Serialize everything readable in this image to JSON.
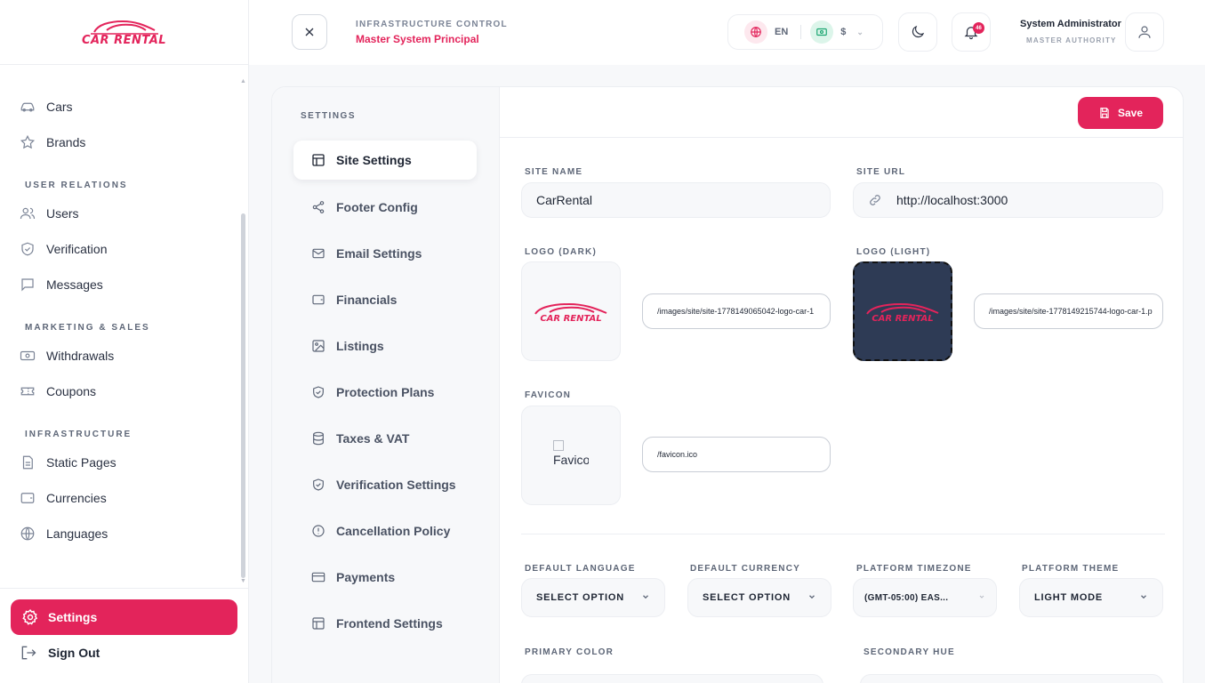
{
  "brand": {
    "logo_text": "CAR RENTAL",
    "accent": "#e3245b"
  },
  "sidebar": {
    "items_top": [
      {
        "label": "Cars",
        "icon": "car-icon"
      },
      {
        "label": "Brands",
        "icon": "star-icon"
      }
    ],
    "sections": [
      {
        "title": "USER RELATIONS",
        "items": [
          {
            "label": "Users",
            "icon": "users-icon"
          },
          {
            "label": "Verification",
            "icon": "shield-check-icon"
          },
          {
            "label": "Messages",
            "icon": "message-icon"
          }
        ]
      },
      {
        "title": "MARKETING & SALES",
        "items": [
          {
            "label": "Withdrawals",
            "icon": "banknote-icon"
          },
          {
            "label": "Coupons",
            "icon": "ticket-icon"
          }
        ]
      },
      {
        "title": "INFRASTRUCTURE",
        "items": [
          {
            "label": "Static Pages",
            "icon": "file-icon"
          },
          {
            "label": "Currencies",
            "icon": "wallet-icon"
          },
          {
            "label": "Languages",
            "icon": "globe-icon"
          }
        ]
      }
    ],
    "settings_label": "Settings",
    "signout_label": "Sign Out"
  },
  "header": {
    "kicker": "INFRASTRUCTURE CONTROL",
    "title": "Master System Principal",
    "language": "EN",
    "currency": "$",
    "notifications": "46",
    "user_name": "System Administrator",
    "user_role": "MASTER AUTHORITY"
  },
  "settings_nav": {
    "heading": "SETTINGS",
    "items": [
      {
        "label": "Site Settings",
        "icon": "layout-icon",
        "active": true
      },
      {
        "label": "Footer Config",
        "icon": "share-icon"
      },
      {
        "label": "Email Settings",
        "icon": "mail-icon"
      },
      {
        "label": "Financials",
        "icon": "wallet-icon"
      },
      {
        "label": "Listings",
        "icon": "image-icon"
      },
      {
        "label": "Protection Plans",
        "icon": "shield-check-icon"
      },
      {
        "label": "Taxes & VAT",
        "icon": "database-icon"
      },
      {
        "label": "Verification Settings",
        "icon": "shield-check-icon"
      },
      {
        "label": "Cancellation Policy",
        "icon": "alert-circle-icon"
      },
      {
        "label": "Payments",
        "icon": "credit-card-icon"
      },
      {
        "label": "Frontend Settings",
        "icon": "layout-icon"
      }
    ]
  },
  "form": {
    "save_label": "Save",
    "site_name_label": "SITE NAME",
    "site_name": "CarRental",
    "site_url_label": "SITE URL",
    "site_url": "http://localhost:3000",
    "logo_dark_label": "LOGO (DARK)",
    "logo_dark_path": "/images/site/site-1778149065042-logo-car-1",
    "logo_light_label": "LOGO (LIGHT)",
    "logo_light_path": "/images/site/site-1778149215744-logo-car-1.p",
    "favicon_label": "FAVICON",
    "favicon_alt": "Favicon",
    "favicon_path": "/favicon.ico",
    "default_language_label": "DEFAULT LANGUAGE",
    "default_language": "SELECT OPTION",
    "default_currency_label": "DEFAULT CURRENCY",
    "default_currency": "SELECT OPTION",
    "timezone_label": "PLATFORM TIMEZONE",
    "timezone": "(GMT-05:00) EAS...",
    "theme_label": "PLATFORM THEME",
    "theme": "LIGHT MODE",
    "primary_color_label": "PRIMARY COLOR",
    "secondary_hue_label": "SECONDARY HUE"
  }
}
